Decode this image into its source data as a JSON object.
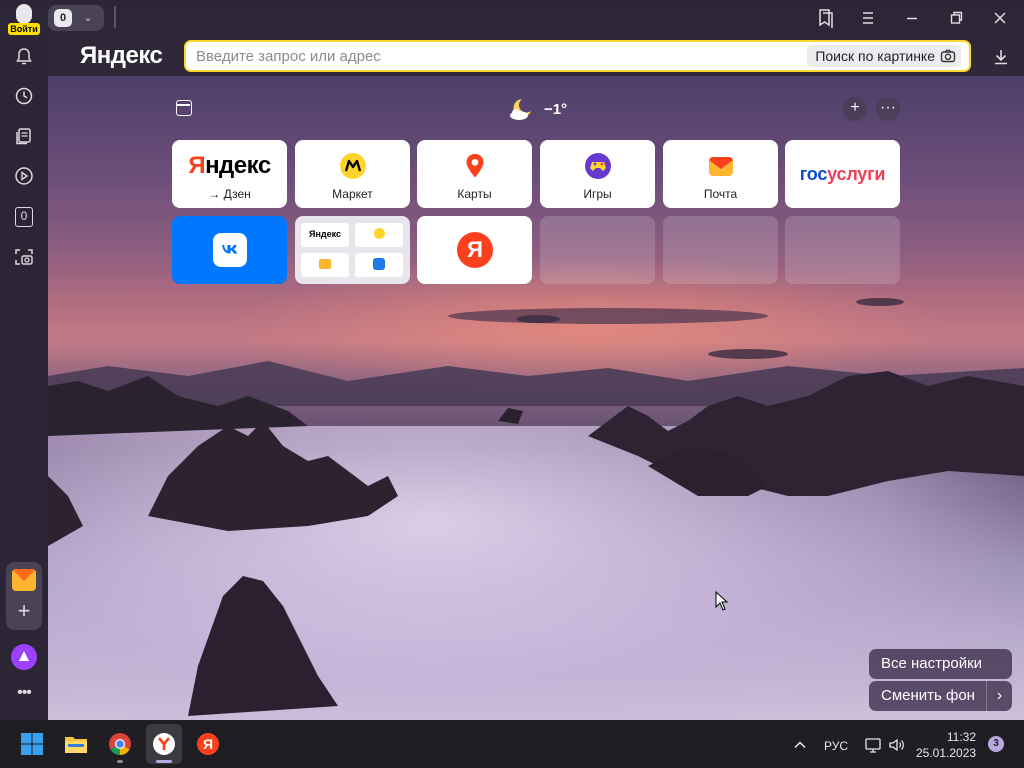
{
  "window": {
    "login_label": "Войти",
    "tab_count": "0"
  },
  "header": {
    "logo": "Яндекс",
    "address_placeholder": "Введите запрос или адрес",
    "image_search_label": "Поиск по картинке"
  },
  "sidebar": {
    "counter": "0"
  },
  "newtab": {
    "weather_temp": "−1°",
    "tiles": [
      {
        "name": "yandex-dzen",
        "logo_ya": "Я",
        "logo_rest": "ндекс",
        "caption": "→ Дзен"
      },
      {
        "name": "market",
        "caption": "Маркет"
      },
      {
        "name": "maps",
        "caption": "Карты"
      },
      {
        "name": "games",
        "caption": "Игры"
      },
      {
        "name": "mail",
        "caption": "Почта"
      },
      {
        "name": "gosuslugi",
        "logo_blue": "гос",
        "logo_red": "услуги"
      }
    ],
    "row2": {
      "yandex_mini_logo": "Яндекс",
      "ya_letter": "Я"
    },
    "all_settings": "Все настройки",
    "change_bg": "Сменить фон"
  },
  "taskbar": {
    "lang": "РУС",
    "time": "11:32",
    "date": "25.01.2023",
    "notifications": "3"
  },
  "colors": {
    "address_border": "#ffd52e",
    "yandex_red": "#fc3f1d",
    "vk_blue": "#0077ff",
    "alice_purple": "#9b40ff"
  }
}
